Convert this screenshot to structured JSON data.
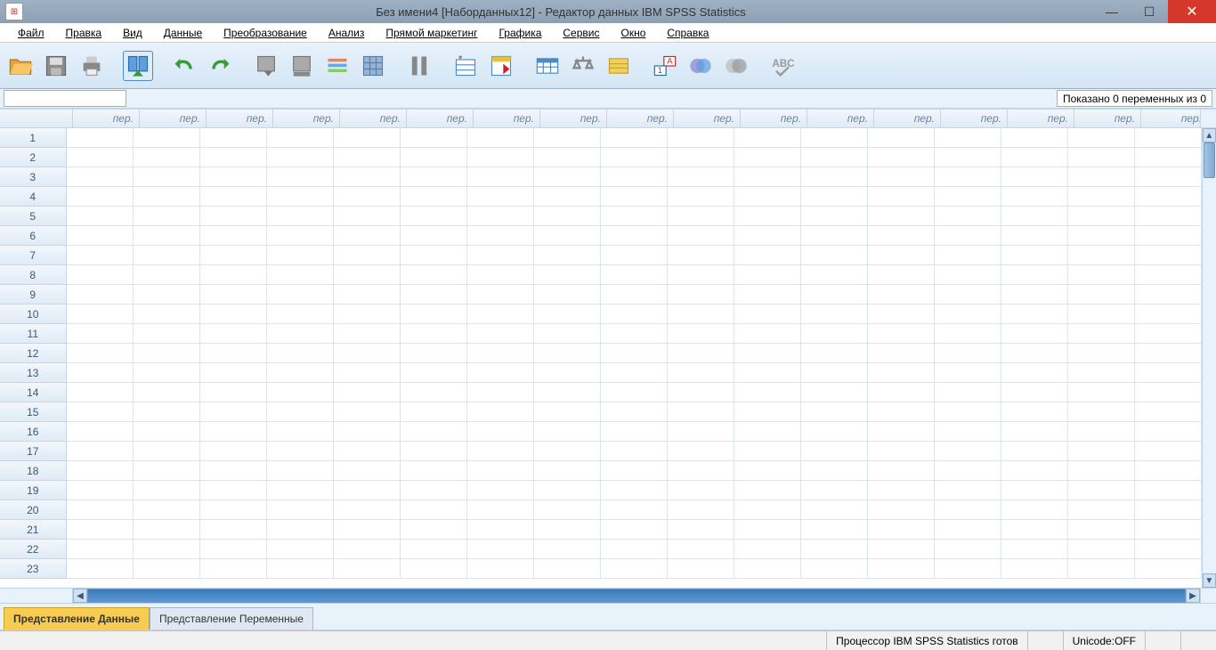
{
  "window": {
    "title": "Без имени4 [Наборданных12] - Редактор данных IBM SPSS Statistics"
  },
  "menu": {
    "file": "Файл",
    "edit": "Правка",
    "view": "Вид",
    "data": "Данные",
    "transform": "Преобразование",
    "analyze": "Анализ",
    "marketing": "Прямой маркетинг",
    "graphics": "Графика",
    "service": "Сервис",
    "window": "Окно",
    "help": "Справка"
  },
  "toolbar_icons": [
    "open-icon",
    "save-icon",
    "print-icon",
    "recall-icon",
    "undo-icon",
    "redo-icon",
    "goto-case-icon",
    "goto-var-icon",
    "variables-icon",
    "run-icon",
    "find-icon",
    "insert-case-icon",
    "insert-var-icon",
    "split-icon",
    "weight-icon",
    "select-icon",
    "value-labels-icon",
    "use-sets-icon",
    "sets-icon",
    "spellcheck-icon"
  ],
  "vars_shown": "Показано 0 переменных из 0",
  "column_label": "пер.",
  "num_columns": 17,
  "num_rows": 23,
  "tabs": {
    "data_view": "Представление Данные",
    "var_view": "Представление Переменные"
  },
  "status": {
    "processor": "Процессор IBM SPSS Statistics  готов",
    "unicode": "Unicode:OFF"
  }
}
